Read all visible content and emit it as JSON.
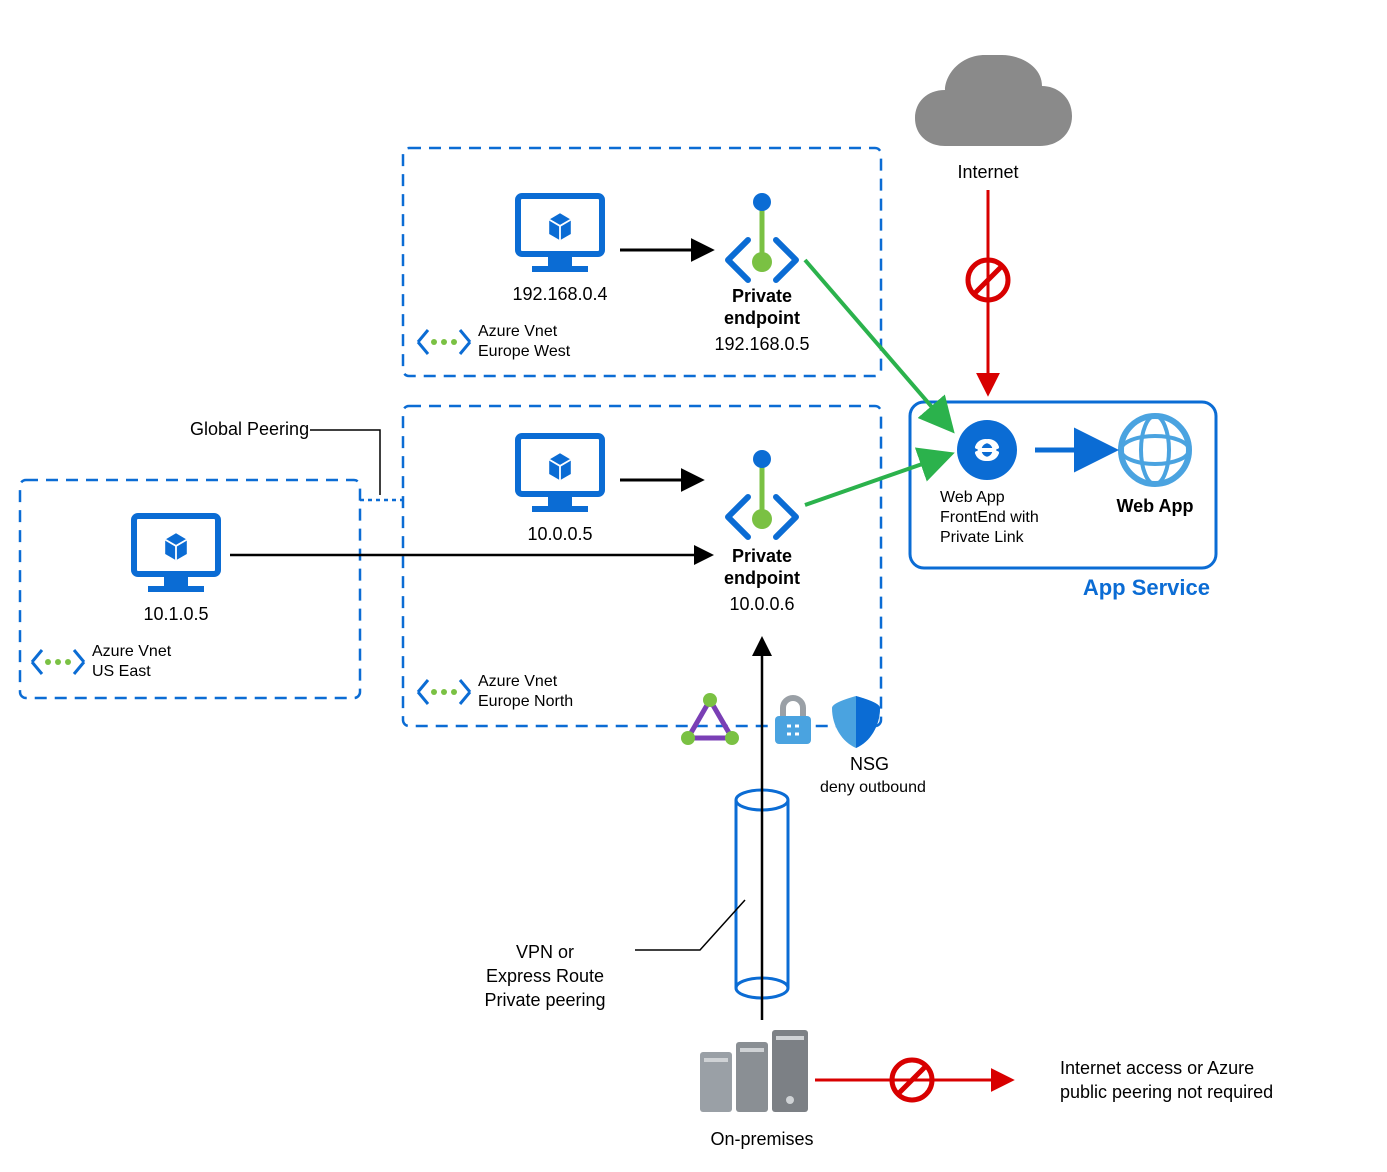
{
  "internet": {
    "label": "Internet"
  },
  "vnet_eu_west": {
    "title_line1": "Azure Vnet",
    "title_line2": "Europe West",
    "vm_ip": "192.168.0.4",
    "pe_title": "Private",
    "pe_title2": "endpoint",
    "pe_ip": "192.168.0.5"
  },
  "vnet_eu_north": {
    "title_line1": "Azure Vnet",
    "title_line2": "Europe North",
    "vm_ip": "10.0.0.5",
    "pe_title": "Private",
    "pe_title2": "endpoint",
    "pe_ip": "10.0.0.6"
  },
  "vnet_us_east": {
    "title_line1": "Azure Vnet",
    "title_line2": "US East",
    "vm_ip": "10.1.0.5"
  },
  "global_peering_label": "Global Peering",
  "nsg": {
    "label": "NSG",
    "sub": "deny outbound"
  },
  "vpn": {
    "line1": "VPN or",
    "line2": "Express Route",
    "line3": "Private peering"
  },
  "onprem": {
    "label": "On-premises"
  },
  "onprem_note": {
    "line1": "Internet access or Azure",
    "line2": "public peering not required"
  },
  "app_service": {
    "box_label": "App Service",
    "frontend_line1": "Web App",
    "frontend_line2": "FrontEnd with",
    "frontend_line3": "Private Link",
    "webapp_label": "Web App"
  }
}
